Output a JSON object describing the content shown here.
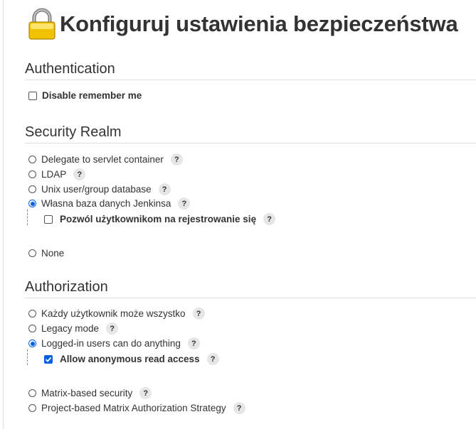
{
  "page": {
    "title": "Konfiguruj ustawienia bezpieczeństwa",
    "icon": "lock-icon"
  },
  "authentication": {
    "heading": "Authentication",
    "disable_remember_me": {
      "label": "Disable remember me",
      "checked": false
    }
  },
  "security_realm": {
    "heading": "Security Realm",
    "options": [
      {
        "label": "Delegate to servlet container",
        "selected": false
      },
      {
        "label": "LDAP",
        "selected": false
      },
      {
        "label": "Unix user/group database",
        "selected": false
      },
      {
        "label": "Własna baza danych Jenkinsa",
        "selected": true
      },
      {
        "label": "None",
        "selected": false
      }
    ],
    "allow_signup": {
      "label": "Pozwól użytkownikom na rejestrowanie się",
      "checked": false
    }
  },
  "authorization": {
    "heading": "Authorization",
    "options": [
      {
        "label": "Każdy użytkownik może wszystko",
        "selected": false
      },
      {
        "label": "Legacy mode",
        "selected": false
      },
      {
        "label": "Logged-in users can do anything",
        "selected": true
      },
      {
        "label": "Matrix-based security",
        "selected": false
      },
      {
        "label": "Project-based Matrix Authorization Strategy",
        "selected": false
      }
    ],
    "allow_anonymous_read": {
      "label": "Allow anonymous read access",
      "checked": true
    }
  },
  "help_symbol": "?",
  "colors": {
    "accent": "#0060df",
    "help_bg": "#e6e6e6",
    "text": "#333333",
    "lock_gold": "#f2c200"
  }
}
